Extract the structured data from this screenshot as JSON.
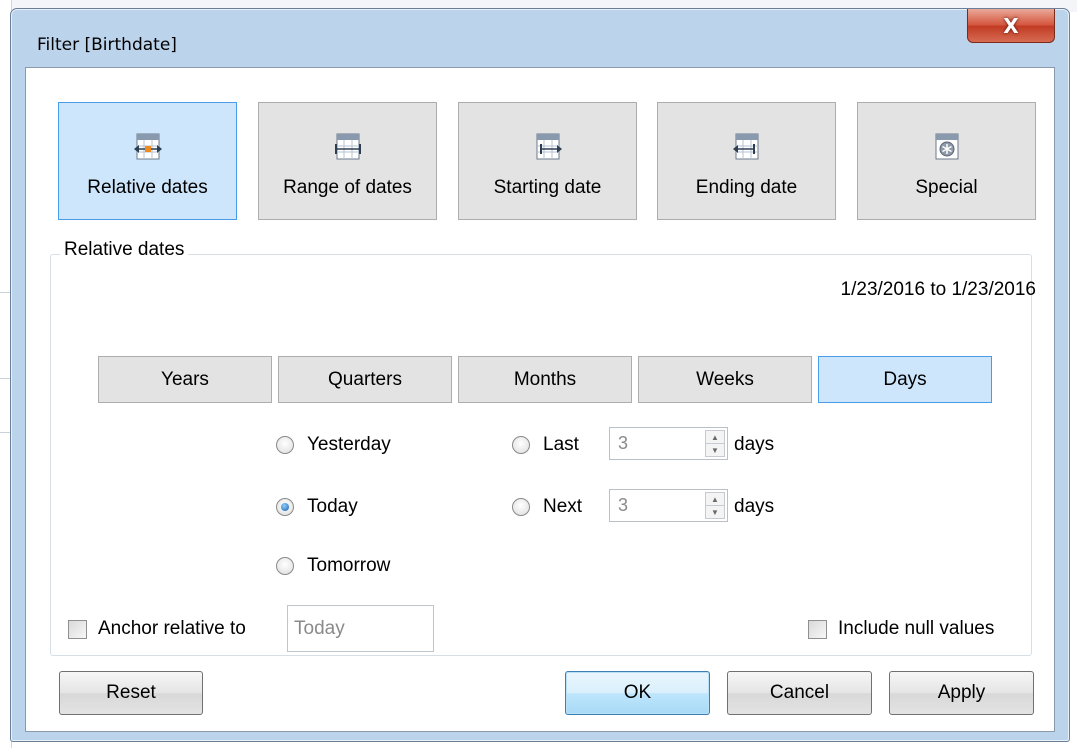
{
  "window": {
    "title": "Filter [Birthdate]",
    "close_glyph": "X"
  },
  "categories": [
    {
      "label": "Relative dates",
      "icon": "relative-dates-icon",
      "active": true
    },
    {
      "label": "Range of dates",
      "icon": "range-of-dates-icon",
      "active": false
    },
    {
      "label": "Starting date",
      "icon": "starting-date-icon",
      "active": false
    },
    {
      "label": "Ending date",
      "icon": "ending-date-icon",
      "active": false
    },
    {
      "label": "Special",
      "icon": "special-icon",
      "active": false
    }
  ],
  "relative": {
    "group_label": "Relative dates",
    "range_text": "1/23/2016 to 1/23/2016",
    "units": [
      {
        "label": "Years",
        "active": false
      },
      {
        "label": "Quarters",
        "active": false
      },
      {
        "label": "Months",
        "active": false
      },
      {
        "label": "Weeks",
        "active": false
      },
      {
        "label": "Days",
        "active": true
      }
    ],
    "options": {
      "yesterday": "Yesterday",
      "today": "Today",
      "tomorrow": "Tomorrow",
      "last": "Last",
      "next": "Next",
      "selected": "today"
    },
    "last_value": "3",
    "next_value": "3",
    "unit_word": "days",
    "anchor_label": "Anchor relative to",
    "anchor_value": "Today",
    "anchor_checked": false,
    "null_label": "Include null values",
    "null_checked": false
  },
  "footer": {
    "reset": "Reset",
    "ok": "OK",
    "cancel": "Cancel",
    "apply": "Apply"
  },
  "colors": {
    "frame": "#bcd3ec",
    "active_fill": "#cde6fb",
    "active_border": "#4a9ce8",
    "button_fill": "#e3e3e3",
    "close_red": "#c13a22"
  }
}
